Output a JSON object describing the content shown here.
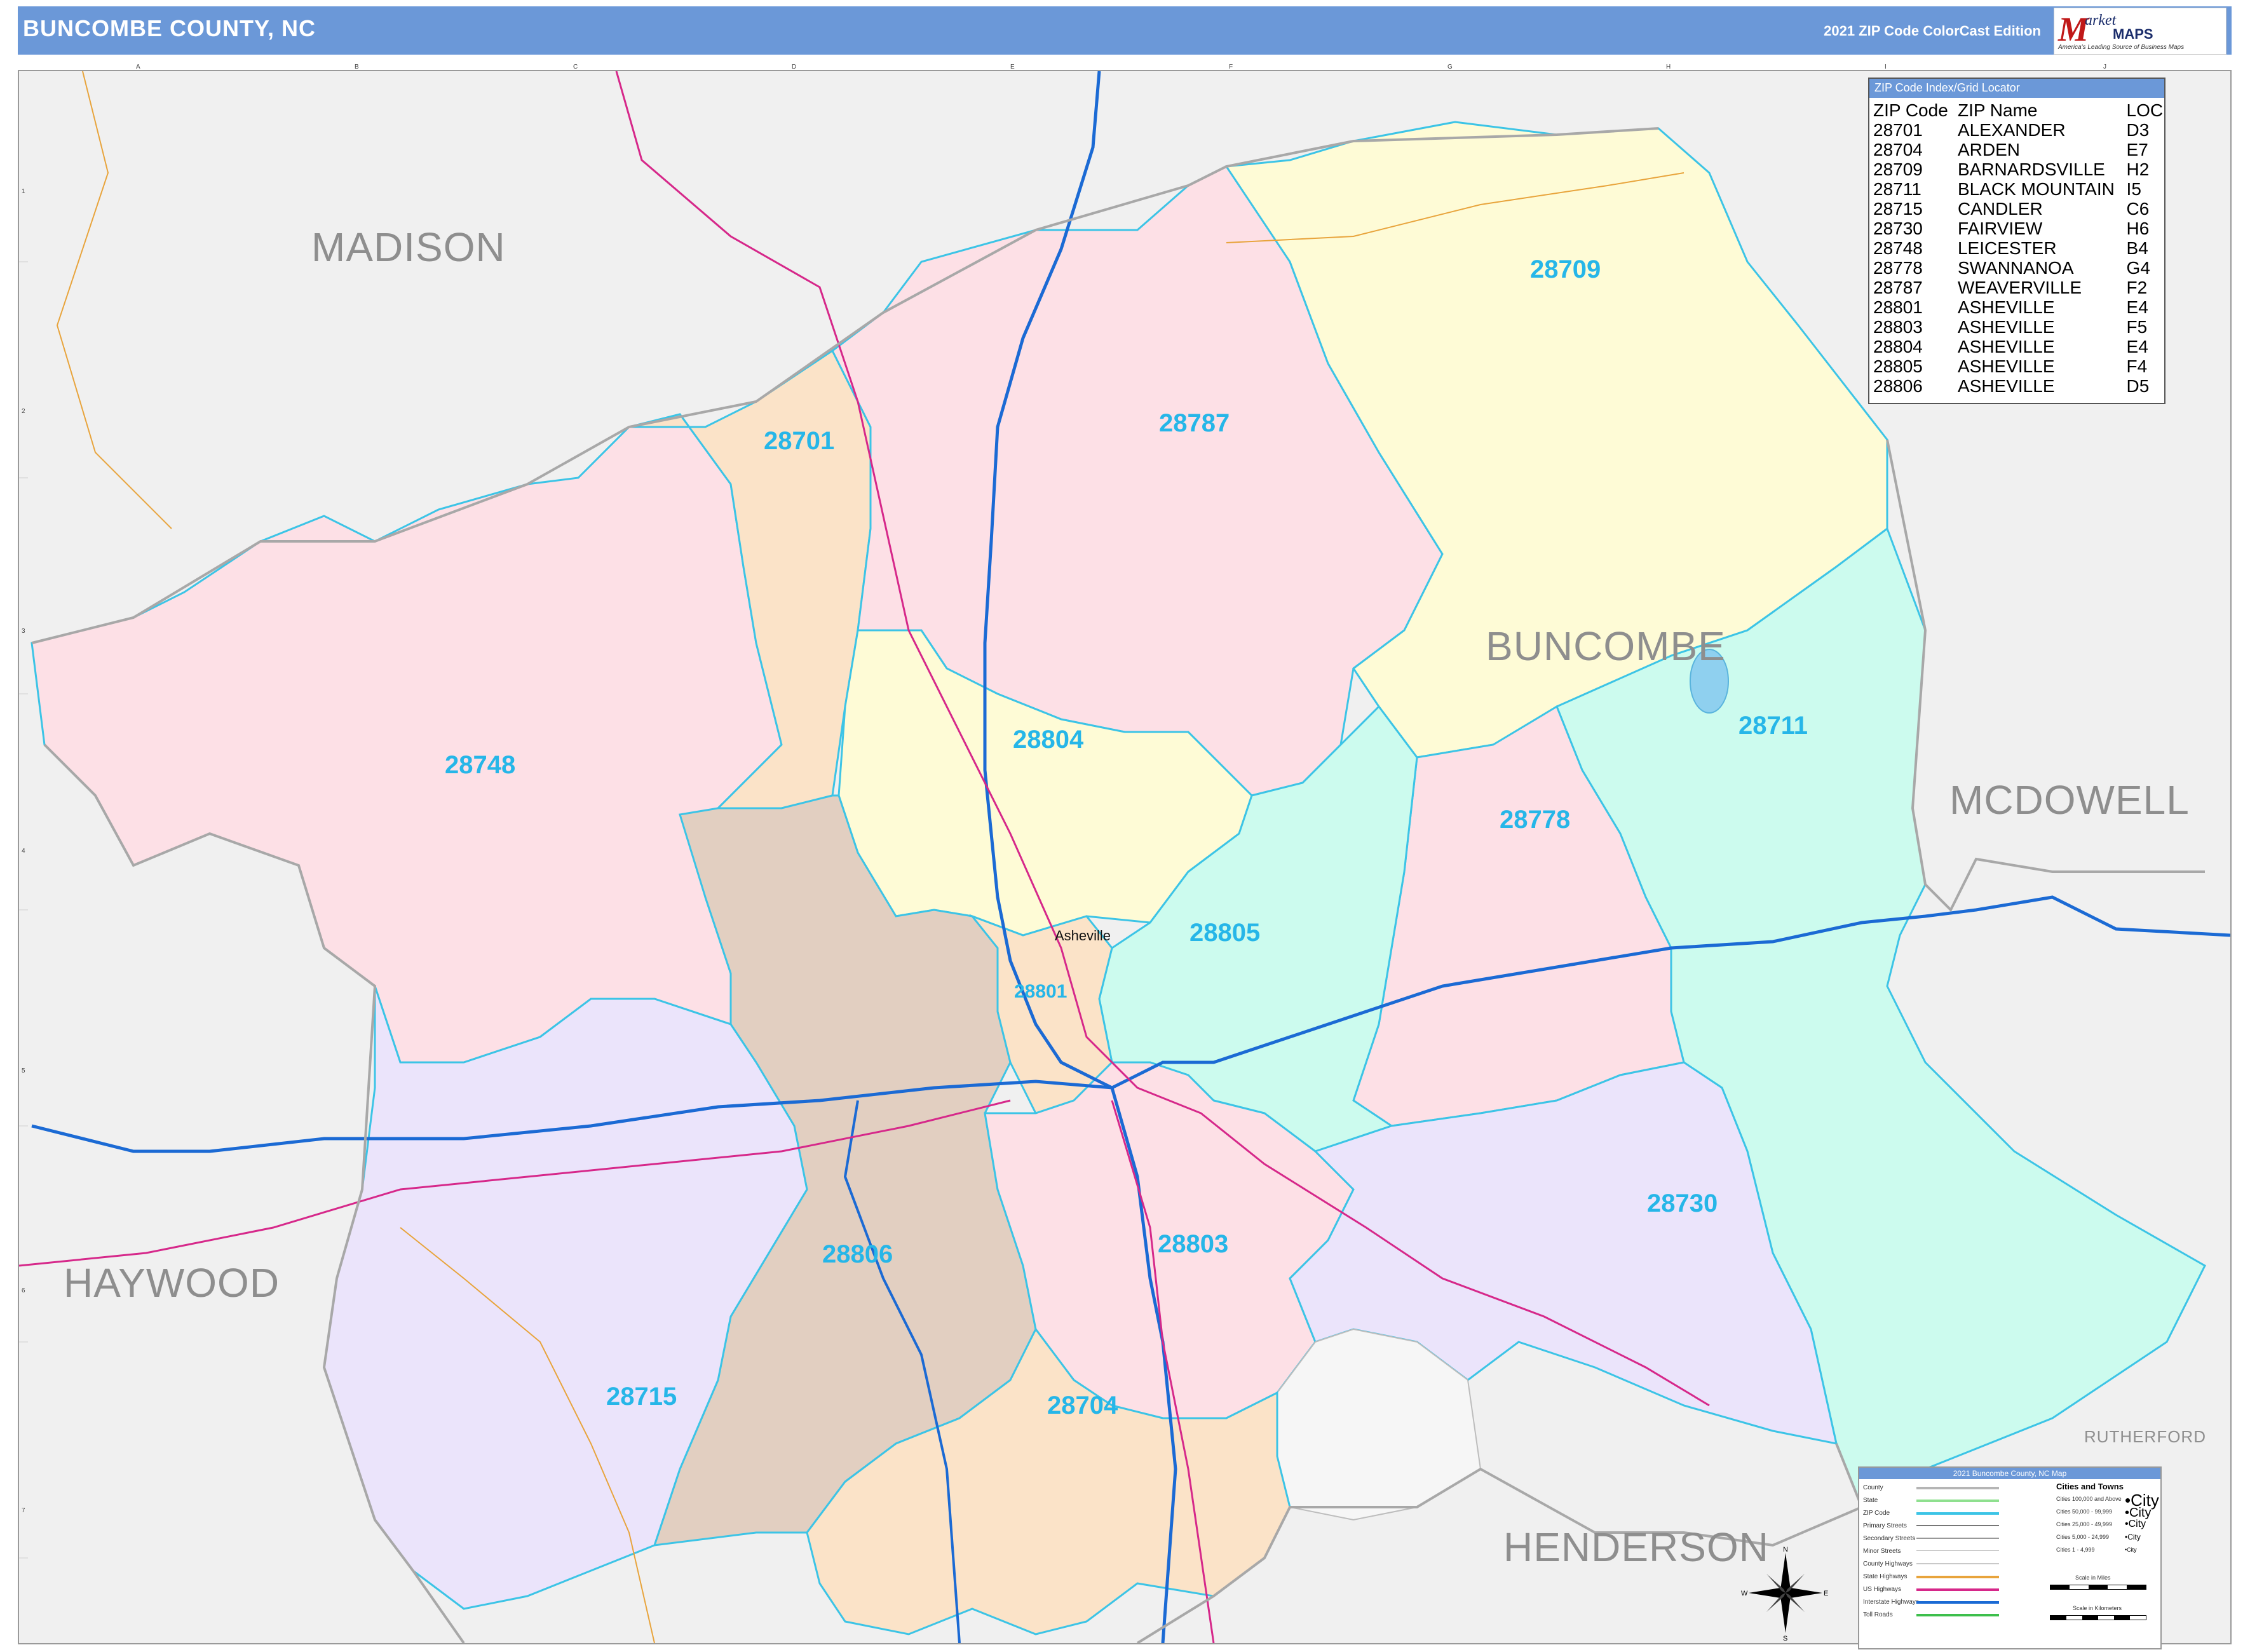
{
  "header": {
    "title": "BUNCOMBE COUNTY, NC",
    "edition": "2021 ZIP Code ColorCast Edition"
  },
  "logo": {
    "m": "M",
    "name": "arket",
    "maps": "MAPS",
    "tagline": "America's Leading Source of Business Maps"
  },
  "counties": {
    "madison": "MADISON",
    "buncombe": "BUNCOMBE",
    "mcdowell": "MCDOWELL",
    "haywood": "HAYWOOD",
    "henderson": "HENDERSON",
    "rutherford": "RUTHERFORD"
  },
  "zip_labels": {
    "z28709": "28709",
    "z28787": "28787",
    "z28701": "28701",
    "z28748": "28748",
    "z28804": "28804",
    "z28711": "28711",
    "z28778": "28778",
    "z28805": "28805",
    "z28801": "28801",
    "z28806": "28806",
    "z28803": "28803",
    "z28730": "28730",
    "z28715": "28715",
    "z28704": "28704"
  },
  "city": {
    "asheville": "Asheville"
  },
  "index": {
    "title": "ZIP Code Index/Grid Locator",
    "headers": [
      "ZIP Code",
      "ZIP Name",
      "LOC"
    ],
    "rows": [
      [
        "28701",
        "ALEXANDER",
        "D3"
      ],
      [
        "28704",
        "ARDEN",
        "E7"
      ],
      [
        "28709",
        "BARNARDSVILLE",
        "H2"
      ],
      [
        "28711",
        "BLACK MOUNTAIN",
        "I5"
      ],
      [
        "28715",
        "CANDLER",
        "C6"
      ],
      [
        "28730",
        "FAIRVIEW",
        "H6"
      ],
      [
        "28748",
        "LEICESTER",
        "B4"
      ],
      [
        "28778",
        "SWANNANOA",
        "G4"
      ],
      [
        "28787",
        "WEAVERVILLE",
        "F2"
      ],
      [
        "28801",
        "ASHEVILLE",
        "E4"
      ],
      [
        "28803",
        "ASHEVILLE",
        "F5"
      ],
      [
        "28804",
        "ASHEVILLE",
        "E4"
      ],
      [
        "28805",
        "ASHEVILLE",
        "F4"
      ],
      [
        "28806",
        "ASHEVILLE",
        "D5"
      ]
    ]
  },
  "legend": {
    "title": "2021 Buncombe County, NC Map",
    "rows": [
      "County",
      "State",
      "ZIP Code",
      "Primary Streets",
      "Secondary Streets",
      "Minor Streets",
      "County Highways",
      "State Highways",
      "US Highways",
      "Interstate Highways",
      "Toll Roads"
    ],
    "cities_title": "Cities and Towns",
    "city_rows": [
      "Cities 100,000 and Above",
      "Cities 50,000 - 99,999",
      "Cities 25,000 - 49,999",
      "Cities 5,000 - 24,999",
      "Cities 1 - 4,999"
    ],
    "city_symbols": [
      "•City",
      "•City",
      "•City",
      "•City",
      "•City"
    ],
    "scale_miles": "Scale in Miles",
    "scale_km": "Scale in Kilometers"
  },
  "compass": {
    "n": "N",
    "s": "S",
    "e": "E",
    "w": "W"
  },
  "grid": {
    "cols": [
      "A",
      "B",
      "C",
      "D",
      "E",
      "F",
      "G",
      "H",
      "I",
      "J"
    ],
    "rows": [
      "1",
      "2",
      "3",
      "4",
      "5",
      "6",
      "7"
    ]
  },
  "colors": {
    "header": "#6b98d8",
    "zip_text": "#26b6e8",
    "pink": "#fde0e6",
    "yellow": "#fefbd6",
    "peach": "#fbe3c8",
    "aqua": "#ccfbee",
    "lavender": "#ebe4fb",
    "tan": "#e2cfc1",
    "outside": "#efefef"
  }
}
